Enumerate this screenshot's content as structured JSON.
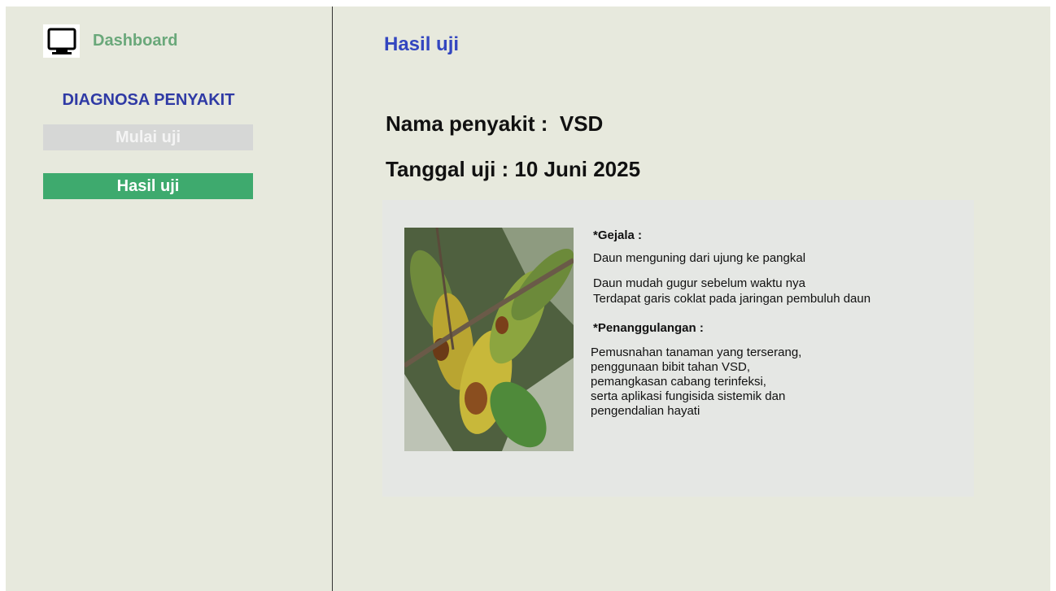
{
  "sidebar": {
    "dashboard_label": "Dashboard",
    "dashboard_icon": "monitor-icon",
    "section_title": "DIAGNOSA PENYAKIT",
    "menu": [
      {
        "label": "Mulai uji",
        "state": "inactive"
      },
      {
        "label": "Hasil uji",
        "state": "active"
      }
    ]
  },
  "main": {
    "title": "Hasil uji",
    "nama_penyakit": "Nama penyakit :  VSD",
    "tanggal_uji": "Tanggal uji : 10 Juni 2025",
    "gejala_header": "*Gejala :",
    "gejala": [
      "Daun menguning dari ujung ke pangkal",
      "Daun mudah gugur sebelum waktu nya",
      "Terdapat garis coklat pada jaringan pembuluh daun"
    ],
    "penanggulangan_header": "*Penanggulangan :",
    "penanggulangan": [
      "Pemusnahan tanaman yang terserang,",
      "penggunaan bibit tahan VSD,",
      "pemangkasan cabang terinfeksi,",
      "serta aplikasi fungisida sistemik dan",
      "pengendalian hayati"
    ]
  },
  "colors": {
    "background": "#e7e9dd",
    "accent_blue": "#3346c0",
    "section_blue": "#2f3aa5",
    "active_green": "#3eaa6e",
    "dashboard_green": "#6aa87a",
    "inactive_gray": "#d6d7d6",
    "card_bg": "#e5e7e4"
  }
}
